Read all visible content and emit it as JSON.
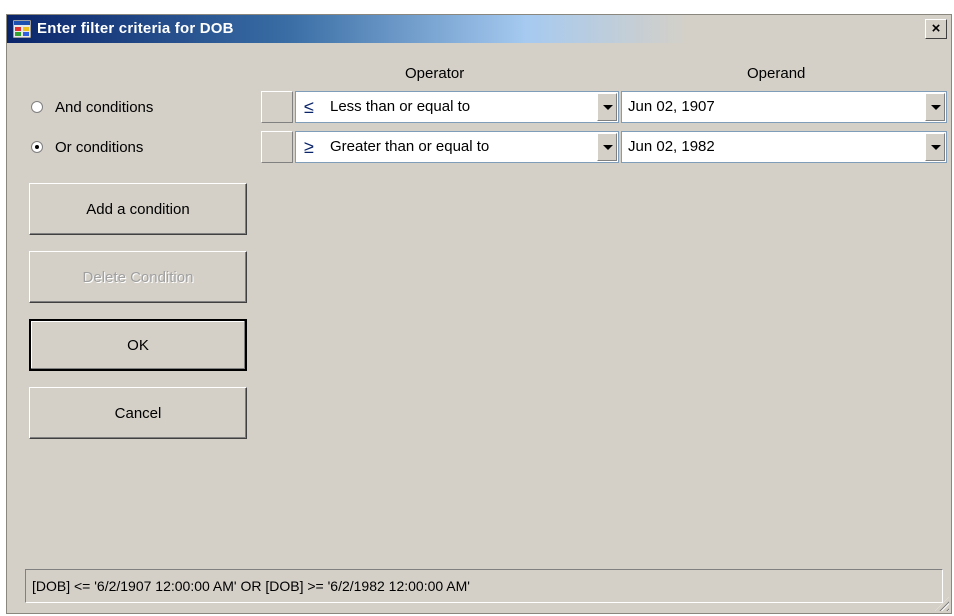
{
  "window": {
    "title": "Enter filter criteria for DOB",
    "close_symbol": "×"
  },
  "headers": {
    "operator": "Operator",
    "operand": "Operand"
  },
  "mode": {
    "and_label": "And conditions",
    "or_label": "Or conditions",
    "selected": "or"
  },
  "conditions": [
    {
      "operator_symbol": "≤",
      "operator_label": "Less than or equal to",
      "operand": "Jun 02, 1907"
    },
    {
      "operator_symbol": "≥",
      "operator_label": "Greater than or equal to",
      "operand": "Jun 02, 1982"
    }
  ],
  "buttons": {
    "add": "Add a condition",
    "delete": "Delete Condition",
    "ok": "OK",
    "cancel": "Cancel"
  },
  "expression": "[DOB] <= '6/2/1907 12:00:00 AM'  OR  [DOB] >= '6/2/1982 12:00:00 AM'",
  "icons": {
    "title": "app-window-icon",
    "close": "close-icon",
    "dropdown": "chevron-down-icon",
    "resize": "resize-grip-icon"
  }
}
